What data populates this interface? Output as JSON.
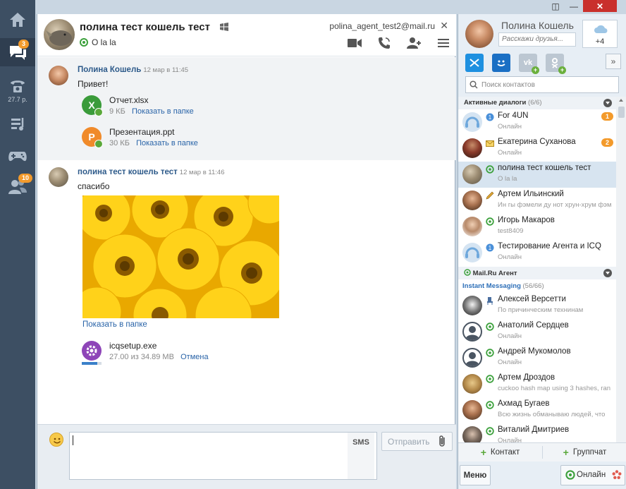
{
  "window": {
    "titlebar": {
      "restore_icon": "◫",
      "minimize_icon": "—",
      "close_icon": "✕"
    }
  },
  "leftnav": {
    "items": [
      {
        "name": "home",
        "icon": "home-icon"
      },
      {
        "name": "chats",
        "icon": "chat-icon",
        "badge": "3"
      },
      {
        "name": "phone",
        "icon": "phone-icon",
        "sublabel": "27.7 р."
      },
      {
        "name": "music",
        "icon": "music-icon"
      },
      {
        "name": "games",
        "icon": "gamepad-icon"
      },
      {
        "name": "contacts",
        "icon": "people-icon",
        "badge": "10"
      }
    ]
  },
  "chat": {
    "header": {
      "name": "полина тест кошель тест",
      "status": "O la la",
      "email": "polina_agent_test2@mail.ru",
      "close": "✕"
    },
    "messages": [
      {
        "author": "Полина Кошель",
        "time": "12 мар в 11:45",
        "text": "Привет!",
        "files": [
          {
            "name": "Отчет.xlsx",
            "size": "9 КБ",
            "action": "Показать в папке",
            "icon_letter": "X",
            "color": "#3a9b3a"
          },
          {
            "name": "Презентация.ppt",
            "size": "30 КБ",
            "action": "Показать в папке",
            "icon_letter": "P",
            "color": "#f08a2a"
          }
        ]
      },
      {
        "author": "полина тест кошель тест",
        "time": "12 мар в 11:46",
        "text": "спасибо",
        "image_action": "Показать в папке",
        "download": {
          "name": "icqsetup.exe",
          "progress_text": "27.00 из 34.89 МВ",
          "action": "Отмена",
          "progress": 0.77
        }
      }
    ],
    "input": {
      "value": "",
      "sms_label": "SMS",
      "send_label": "Отправить"
    }
  },
  "profile": {
    "name": "Полина Кошель",
    "status_placeholder": "Расскажи друзья...",
    "weather": "+4"
  },
  "search": {
    "placeholder": "Поиск контактов"
  },
  "sections": {
    "active": {
      "title": "Активные диалоги",
      "count": "(6/6)"
    },
    "agent": {
      "title": "Mail.Ru Агент"
    },
    "im": {
      "title": "Instant Messaging",
      "count": "(56/66)"
    }
  },
  "active_dialogs": [
    {
      "name": "For 4UN",
      "sub": "Онлайн",
      "badge": "1",
      "icon": "icq-icon"
    },
    {
      "name": "Екатерина Суханова",
      "sub": "Онлайн",
      "badge": "2",
      "icon": "envelope-icon"
    },
    {
      "name": "полина тест кошель тест",
      "sub": "O la la",
      "icon": "at-icon",
      "selected": true
    },
    {
      "name": "Артем Ильинский",
      "sub": "Ин гы фэмели ду нот хрун-хрум фэм",
      "icon": "pencil-icon"
    },
    {
      "name": "Игорь Макаров",
      "sub": "test8409",
      "icon": "at-icon"
    },
    {
      "name": "Тестирование Агента и ICQ",
      "sub": "Онлайн",
      "icon": "icq-icon"
    }
  ],
  "im_contacts": [
    {
      "name": "Алексей Версетти",
      "sub": "По причинческим технинам",
      "icon": "chair-icon"
    },
    {
      "name": "Анатолий Сердцев",
      "sub": "Онлайн",
      "icon": "at-icon"
    },
    {
      "name": "Андрей Мукомолов",
      "sub": "Онлайн",
      "icon": "at-icon"
    },
    {
      "name": "Артем Дроздов",
      "sub": "cuckoo hash map using 3 hashes, ran",
      "icon": "at-icon"
    },
    {
      "name": "Ахмад Бугаев",
      "sub": "Всю жизнь обманываю людей, что",
      "icon": "at-icon"
    },
    {
      "name": "Виталий Дмитриев",
      "sub": "Онлайн",
      "icon": "at-icon"
    }
  ],
  "bottom": {
    "add_contact": "Контакт",
    "add_group": "Группчат",
    "menu": "Меню",
    "online": "Онлайн"
  }
}
